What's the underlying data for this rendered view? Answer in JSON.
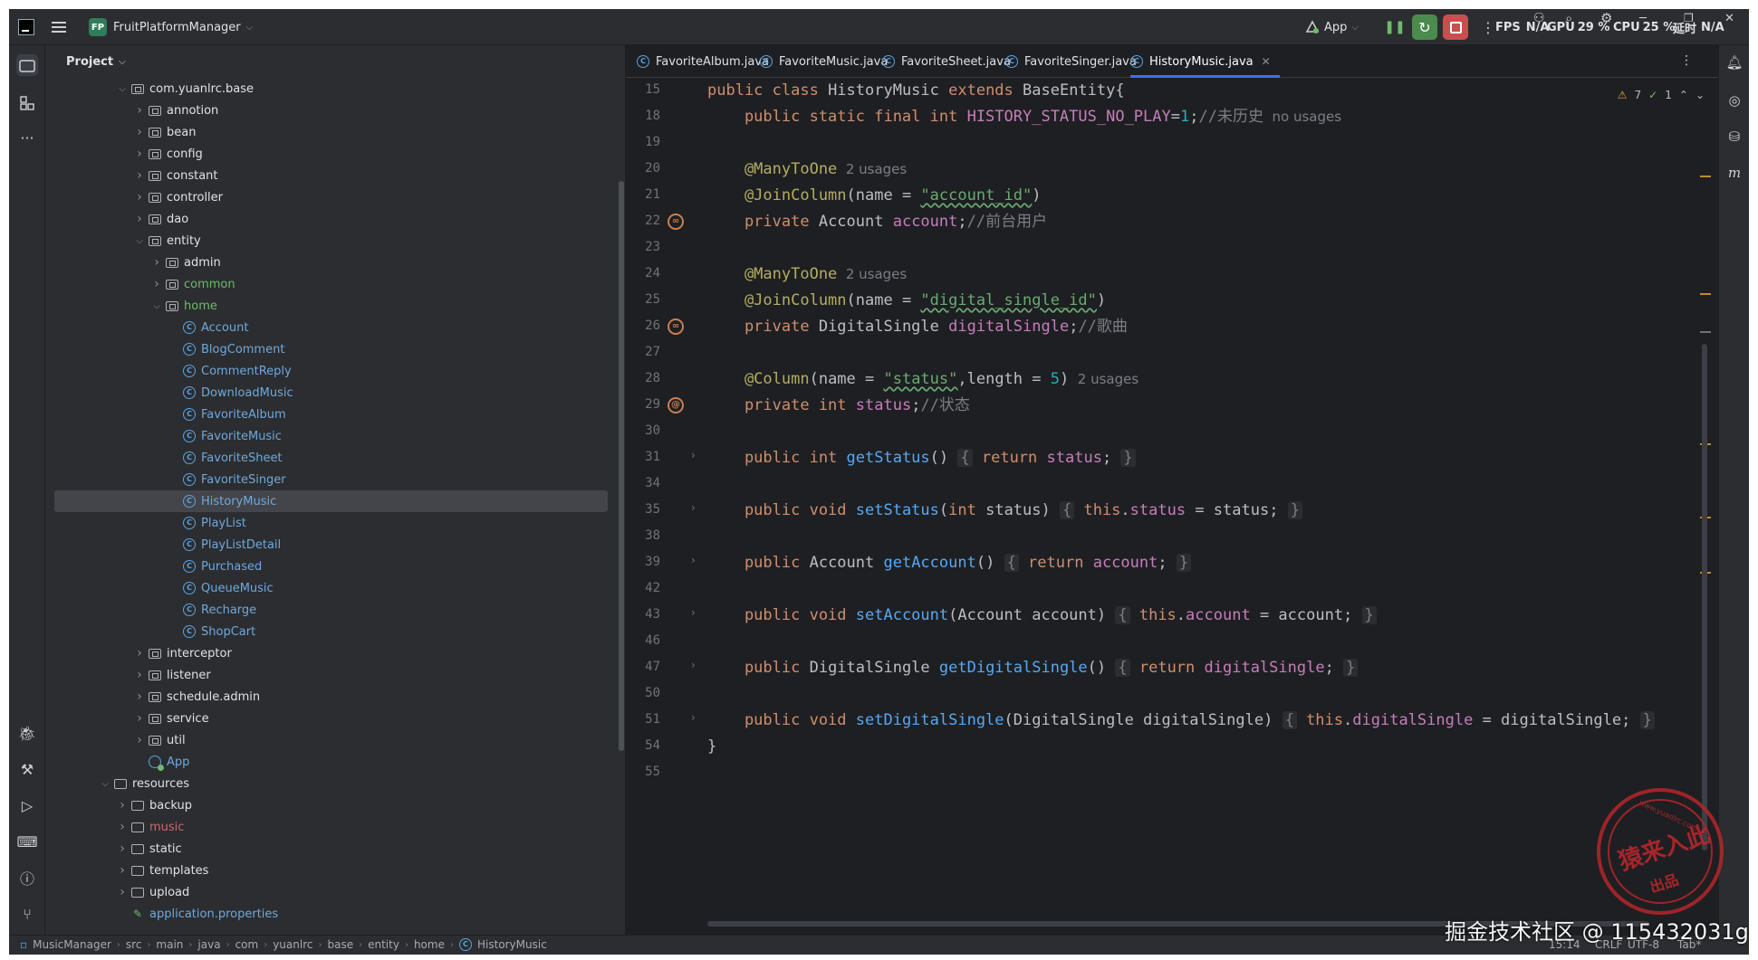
{
  "titlebar": {
    "project_badge": "FP",
    "project_name": "FruitPlatformManager",
    "run_config": "App",
    "fps_label": "FPS",
    "fps_value": "N/A",
    "gpu_label": "GPU",
    "gpu_value": "29 %",
    "cpu_label": "CPU",
    "cpu_value": "25 %",
    "latency_label": "延时",
    "latency_value": "N/A"
  },
  "project_panel": {
    "title": "Project",
    "tree": [
      {
        "label": "com.yuanlrc.base",
        "depth": 0,
        "kind": "package",
        "expanded": true
      },
      {
        "label": "annotion",
        "depth": 1,
        "kind": "package"
      },
      {
        "label": "bean",
        "depth": 1,
        "kind": "package"
      },
      {
        "label": "config",
        "depth": 1,
        "kind": "package"
      },
      {
        "label": "constant",
        "depth": 1,
        "kind": "package"
      },
      {
        "label": "controller",
        "depth": 1,
        "kind": "package"
      },
      {
        "label": "dao",
        "depth": 1,
        "kind": "package"
      },
      {
        "label": "entity",
        "depth": 1,
        "kind": "package",
        "expanded": true
      },
      {
        "label": "admin",
        "depth": 2,
        "kind": "package"
      },
      {
        "label": "common",
        "depth": 2,
        "kind": "package",
        "vcs": "green"
      },
      {
        "label": "home",
        "depth": 2,
        "kind": "package",
        "expanded": true,
        "vcs": "green"
      },
      {
        "label": "Account",
        "depth": 3,
        "kind": "class"
      },
      {
        "label": "BlogComment",
        "depth": 3,
        "kind": "class"
      },
      {
        "label": "CommentReply",
        "depth": 3,
        "kind": "class"
      },
      {
        "label": "DownloadMusic",
        "depth": 3,
        "kind": "class"
      },
      {
        "label": "FavoriteAlbum",
        "depth": 3,
        "kind": "class"
      },
      {
        "label": "FavoriteMusic",
        "depth": 3,
        "kind": "class"
      },
      {
        "label": "FavoriteSheet",
        "depth": 3,
        "kind": "class"
      },
      {
        "label": "FavoriteSinger",
        "depth": 3,
        "kind": "class"
      },
      {
        "label": "HistoryMusic",
        "depth": 3,
        "kind": "class",
        "selected": true
      },
      {
        "label": "PlayList",
        "depth": 3,
        "kind": "class"
      },
      {
        "label": "PlayListDetail",
        "depth": 3,
        "kind": "class"
      },
      {
        "label": "Purchased",
        "depth": 3,
        "kind": "class"
      },
      {
        "label": "QueueMusic",
        "depth": 3,
        "kind": "class"
      },
      {
        "label": "Recharge",
        "depth": 3,
        "kind": "class"
      },
      {
        "label": "ShopCart",
        "depth": 3,
        "kind": "class"
      },
      {
        "label": "interceptor",
        "depth": 1,
        "kind": "package"
      },
      {
        "label": "listener",
        "depth": 1,
        "kind": "package"
      },
      {
        "label": "schedule.admin",
        "depth": 1,
        "kind": "package"
      },
      {
        "label": "service",
        "depth": 1,
        "kind": "package"
      },
      {
        "label": "util",
        "depth": 1,
        "kind": "package"
      },
      {
        "label": "App",
        "depth": 1,
        "kind": "app"
      },
      {
        "label": "resources",
        "depth": -1,
        "kind": "folder",
        "expanded": true
      },
      {
        "label": "backup",
        "depth": 0,
        "kind": "folder"
      },
      {
        "label": "music",
        "depth": 0,
        "kind": "folder",
        "vcs": "red"
      },
      {
        "label": "static",
        "depth": 0,
        "kind": "folder"
      },
      {
        "label": "templates",
        "depth": 0,
        "kind": "folder"
      },
      {
        "label": "upload",
        "depth": 0,
        "kind": "folder"
      },
      {
        "label": "application.properties",
        "depth": 0,
        "kind": "file"
      }
    ]
  },
  "tabs": [
    {
      "label": "FavoriteAlbum.java",
      "active": false
    },
    {
      "label": "FavoriteMusic.java",
      "active": false
    },
    {
      "label": "FavoriteSheet.java",
      "active": false
    },
    {
      "label": "FavoriteSinger.java",
      "active": false
    },
    {
      "label": "HistoryMusic.java",
      "active": true
    }
  ],
  "inspections": {
    "warnings": "7",
    "ok": "1"
  },
  "code_lines": [
    {
      "n": "15",
      "tokens": [
        [
          "kw",
          "public class "
        ],
        [
          "plain",
          "HistoryMusic "
        ],
        [
          "kw",
          "extends "
        ],
        [
          "plain",
          "BaseEntity{"
        ]
      ]
    },
    {
      "n": "18",
      "tokens": [
        [
          "kw",
          "    public static final int "
        ],
        [
          "fld",
          "HISTORY_STATUS_NO_PLAY"
        ],
        [
          "plain",
          "="
        ],
        [
          "num",
          "1"
        ],
        [
          "plain",
          ";"
        ],
        [
          "cmt",
          "//未历史"
        ],
        [
          "hint",
          "  no usages"
        ]
      ]
    },
    {
      "n": "19",
      "tokens": []
    },
    {
      "n": "20",
      "tokens": [
        [
          "ann",
          "    @ManyToOne"
        ],
        [
          "hint",
          "  2 usages"
        ]
      ]
    },
    {
      "n": "21",
      "tokens": [
        [
          "ann",
          "    @JoinColumn"
        ],
        [
          "plain",
          "(name = "
        ],
        [
          "str",
          "\"account_id\""
        ],
        [
          "plain",
          ")"
        ]
      ]
    },
    {
      "n": "22",
      "tokens": [
        [
          "kw",
          "    private "
        ],
        [
          "plain",
          "Account "
        ],
        [
          "fld",
          "account"
        ],
        [
          "plain",
          ";"
        ],
        [
          "cmt",
          "//前台用户"
        ]
      ]
    },
    {
      "n": "23",
      "tokens": []
    },
    {
      "n": "24",
      "tokens": [
        [
          "ann",
          "    @ManyToOne"
        ],
        [
          "hint",
          "  2 usages"
        ]
      ]
    },
    {
      "n": "25",
      "tokens": [
        [
          "ann",
          "    @JoinColumn"
        ],
        [
          "plain",
          "(name = "
        ],
        [
          "str",
          "\"digital_single_id\""
        ],
        [
          "plain",
          ")"
        ]
      ]
    },
    {
      "n": "26",
      "tokens": [
        [
          "kw",
          "    private "
        ],
        [
          "plain",
          "DigitalSingle "
        ],
        [
          "fld",
          "digitalSingle"
        ],
        [
          "plain",
          ";"
        ],
        [
          "cmt",
          "//歌曲"
        ]
      ]
    },
    {
      "n": "27",
      "tokens": []
    },
    {
      "n": "28",
      "tokens": [
        [
          "ann",
          "    @Column"
        ],
        [
          "plain",
          "(name = "
        ],
        [
          "str",
          "\"status\""
        ],
        [
          "plain",
          ",length = "
        ],
        [
          "num",
          "5"
        ],
        [
          "plain",
          ")"
        ],
        [
          "hint",
          "  2 usages"
        ]
      ]
    },
    {
      "n": "29",
      "tokens": [
        [
          "kw",
          "    private int "
        ],
        [
          "fld",
          "status"
        ],
        [
          "plain",
          ";"
        ],
        [
          "cmt",
          "//状态"
        ]
      ]
    },
    {
      "n": "30",
      "tokens": []
    },
    {
      "n": "31",
      "tokens": [
        [
          "kw",
          "    public int "
        ],
        [
          "mth",
          "getStatus"
        ],
        [
          "plain",
          "() "
        ],
        [
          "brace",
          "{"
        ],
        [
          "kw",
          " return "
        ],
        [
          "fld",
          "status"
        ],
        [
          "plain",
          "; "
        ],
        [
          "brace",
          "}"
        ]
      ]
    },
    {
      "n": "34",
      "tokens": []
    },
    {
      "n": "35",
      "tokens": [
        [
          "kw",
          "    public void "
        ],
        [
          "mth",
          "setStatus"
        ],
        [
          "plain",
          "("
        ],
        [
          "kw",
          "int "
        ],
        [
          "plain",
          "status) "
        ],
        [
          "brace",
          "{"
        ],
        [
          "kw",
          " this"
        ],
        [
          "plain",
          "."
        ],
        [
          "fld",
          "status"
        ],
        [
          "plain",
          " = status; "
        ],
        [
          "brace",
          "}"
        ]
      ]
    },
    {
      "n": "38",
      "tokens": []
    },
    {
      "n": "39",
      "tokens": [
        [
          "kw",
          "    public "
        ],
        [
          "plain",
          "Account "
        ],
        [
          "mth",
          "getAccount"
        ],
        [
          "plain",
          "() "
        ],
        [
          "brace",
          "{"
        ],
        [
          "kw",
          " return "
        ],
        [
          "fld",
          "account"
        ],
        [
          "plain",
          "; "
        ],
        [
          "brace",
          "}"
        ]
      ]
    },
    {
      "n": "42",
      "tokens": []
    },
    {
      "n": "43",
      "tokens": [
        [
          "kw",
          "    public void "
        ],
        [
          "mth",
          "setAccount"
        ],
        [
          "plain",
          "(Account account) "
        ],
        [
          "brace",
          "{"
        ],
        [
          "kw",
          " this"
        ],
        [
          "plain",
          "."
        ],
        [
          "fld",
          "account"
        ],
        [
          "plain",
          " = account; "
        ],
        [
          "brace",
          "}"
        ]
      ]
    },
    {
      "n": "46",
      "tokens": []
    },
    {
      "n": "47",
      "tokens": [
        [
          "kw",
          "    public "
        ],
        [
          "plain",
          "DigitalSingle "
        ],
        [
          "mth",
          "getDigitalSingle"
        ],
        [
          "plain",
          "() "
        ],
        [
          "brace",
          "{"
        ],
        [
          "kw",
          " return "
        ],
        [
          "fld",
          "digitalSingle"
        ],
        [
          "plain",
          "; "
        ],
        [
          "brace",
          "}"
        ]
      ]
    },
    {
      "n": "50",
      "tokens": []
    },
    {
      "n": "51",
      "tokens": [
        [
          "kw",
          "    public void "
        ],
        [
          "mth",
          "setDigitalSingle"
        ],
        [
          "plain",
          "(DigitalSingle digitalSingle) "
        ],
        [
          "brace",
          "{"
        ],
        [
          "kw",
          " this"
        ],
        [
          "plain",
          "."
        ],
        [
          "fld",
          "digitalSingle"
        ],
        [
          "plain",
          " = digitalSingle; "
        ],
        [
          "brace",
          "}"
        ]
      ]
    },
    {
      "n": "54",
      "tokens": [
        [
          "plain",
          "}"
        ]
      ]
    },
    {
      "n": "55",
      "tokens": []
    }
  ],
  "statusbar": {
    "breadcrumbs": [
      "MusicManager",
      "src",
      "main",
      "java",
      "com",
      "yuanlrc",
      "base",
      "entity",
      "home",
      "HistoryMusic"
    ],
    "position": "15:14",
    "line_sep": "CRLF",
    "encoding": "UTF-8",
    "indent": "Tab*"
  },
  "watermark": {
    "stamp_text": "猿来入此",
    "stamp_sub": "出品",
    "stamp_url": "www.yuanlrc.com",
    "text": "掘金技术社区 @ 115432031g"
  },
  "colors": {
    "accent": "#3574f0",
    "keyword": "#cf8e6d",
    "annotation": "#b3ae60",
    "string": "#6aab73",
    "field": "#c77dbb",
    "method": "#56a8f5",
    "comment": "#7a7e85",
    "vcs_added": "#6fba6c",
    "vcs_ignored": "#c96a6a",
    "stamp": "#b5262b"
  }
}
